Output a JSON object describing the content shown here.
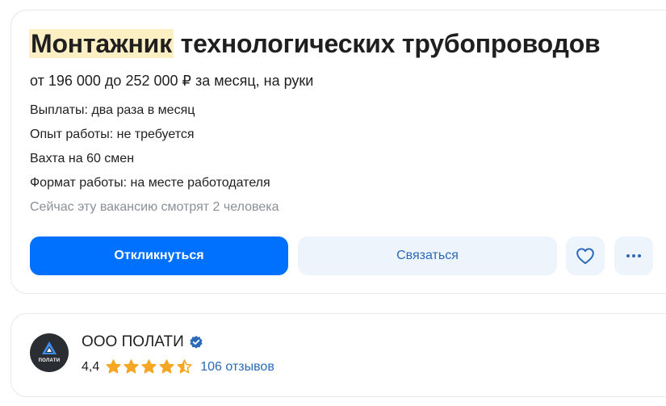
{
  "vacancy": {
    "title_highlight": "Монтажник",
    "title_rest": " технологических трубопроводов",
    "salary": "от 196 000 до 252 000 ₽ за месяц, на руки",
    "info_lines": [
      "Выплаты: два раза в месяц",
      "Опыт работы: не требуется",
      "Вахта на 60 смен",
      "Формат работы: на месте работодателя"
    ],
    "viewers": "Сейчас эту вакансию смотрят 2 человека",
    "actions": {
      "apply_label": "Откликнуться",
      "contact_label": "Связаться",
      "favorite_icon": "heart-icon",
      "more_icon": "more-dots-icon"
    }
  },
  "company": {
    "logo_text": "ПОЛАТИ",
    "name": "ООО ПОЛАТИ",
    "verified_icon": "verified-check-icon",
    "rating": "4,4",
    "rating_fraction": 0.88,
    "reviews": "106 отзывов"
  },
  "colors": {
    "primary": "#0070ff",
    "link": "#2b6ab8",
    "star": "#f5a623",
    "highlight": "#fcefc4",
    "muted": "#8a8f98"
  }
}
